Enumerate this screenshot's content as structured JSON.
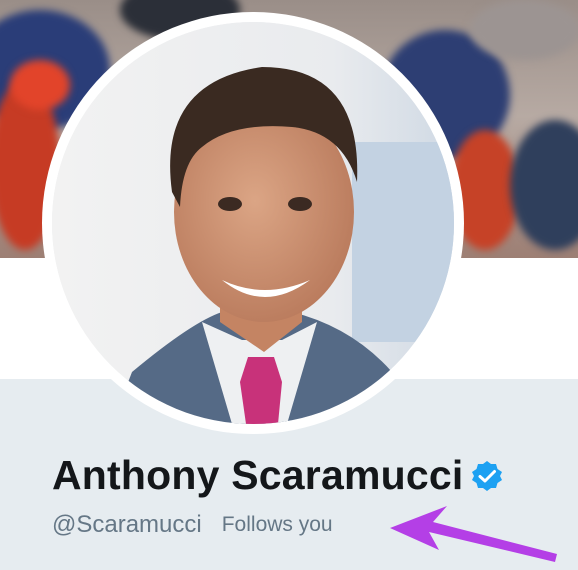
{
  "profile": {
    "display_name": "Anthony Scaramucci",
    "handle": "@Scaramucci",
    "follows_you_label": "Follows you",
    "verified": true
  },
  "icons": {
    "verified": "verified-badge-icon",
    "annotation": "arrow-annotation-icon"
  },
  "colors": {
    "name_text": "#14171a",
    "secondary_text": "#657786",
    "verified_blue": "#1da1f2",
    "info_panel_bg": "#e6ecf0",
    "annotation_arrow": "#b43fe6"
  }
}
